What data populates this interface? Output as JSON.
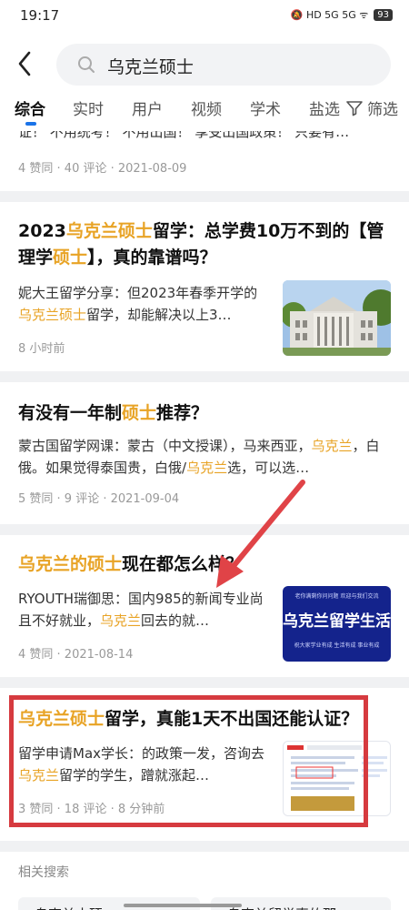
{
  "status": {
    "time": "19:17",
    "icons": "🔕 HD 5G 5G ᯤ",
    "battery": "93"
  },
  "search": {
    "query": "乌克兰硕士"
  },
  "tabs": [
    {
      "label": "综合"
    },
    {
      "label": "实时"
    },
    {
      "label": "用户"
    },
    {
      "label": "视频"
    },
    {
      "label": "学术"
    },
    {
      "label": "盐选"
    }
  ],
  "filter": {
    "label": "筛选"
  },
  "cards": [
    {
      "snippet_cut": "证！ 不用统考！ 不用出国！ 享受出国政策！ 只要有…",
      "meta": "4 赞同 · 40 评论 · 2021-08-09"
    },
    {
      "title_parts": [
        "2023",
        "乌克兰硕士",
        "留学：总学费10万不到的【管理学",
        "硕士",
        "】，真的靠谱吗？"
      ],
      "snippet_parts": [
        "妮大王留学分享：但2023年春季开学的",
        "乌克兰硕士",
        "留学，却能解决以上3…"
      ],
      "meta": "8 小时前"
    },
    {
      "title_parts": [
        "有没有一年制",
        "硕士",
        "推荐？"
      ],
      "snippet_parts": [
        "蒙古国留学网课：蒙古（中文授课），马来西亚，",
        "乌克兰",
        "，白俄。如果觉得泰国贵，白俄/",
        "乌克兰",
        "选，可以选…"
      ],
      "meta": "5 赞同 · 9 评论 · 2021-09-04"
    },
    {
      "title_parts": [
        "乌克兰的硕士",
        "现在都怎么样？"
      ],
      "snippet_parts": [
        "RYOUTH瑞御思：国内985的新闻专业尚且不好就业，",
        "乌克兰",
        "回去的就…"
      ],
      "meta": "4 赞同 · 2021-08-14",
      "thumb_text": "乌克兰留学生活",
      "thumb_top": "老你满剩你问问题 欢迎与我们交流",
      "thumb_bottom": "祝大家学业有成 生活有成 事业有成"
    },
    {
      "title_parts": [
        "乌克兰硕士",
        "留学，真能1天不出国还能认证？"
      ],
      "snippet_parts": [
        "留学申请Max学长：的政策一发，咨询去",
        "乌克兰",
        "留学的学生，蹭就涨起…"
      ],
      "meta": "3 赞同 · 18 评论 · 8 分钟前"
    }
  ],
  "related": {
    "label": "相关搜索",
    "chips": [
      "乌克兰水硕",
      "乌克兰留学真的那…"
    ]
  },
  "colors": {
    "accent": "#1a73e8",
    "highlight": "#e8a325",
    "annotation": "#d63a3f"
  }
}
